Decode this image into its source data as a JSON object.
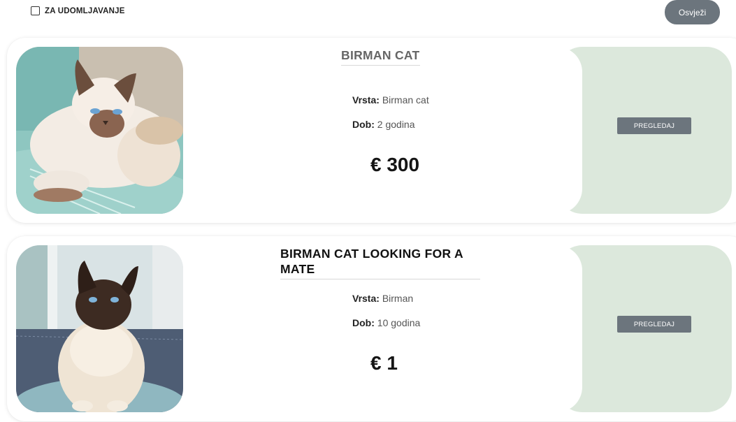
{
  "filter": {
    "adopt_label": "ZA UDOMLJAVANJE"
  },
  "refresh_label": "Osvježi",
  "listings": [
    {
      "title": "BIRMAN CAT",
      "species_label": "Vrsta:",
      "species": "Birman cat",
      "age_label": "Dob:",
      "age": "2 godina",
      "price": "€ 300",
      "button": "PREGLEDAJ"
    },
    {
      "title": "BIRMAN CAT LOOKING FOR A MATE",
      "species_label": "Vrsta:",
      "species": "Birman",
      "age_label": "Dob:",
      "age": "10 godina",
      "price": "€ 1",
      "button": "PREGLEDAJ"
    }
  ],
  "colors": {
    "button_bg": "#6c757d",
    "panel_bg": "#dce8dc"
  }
}
